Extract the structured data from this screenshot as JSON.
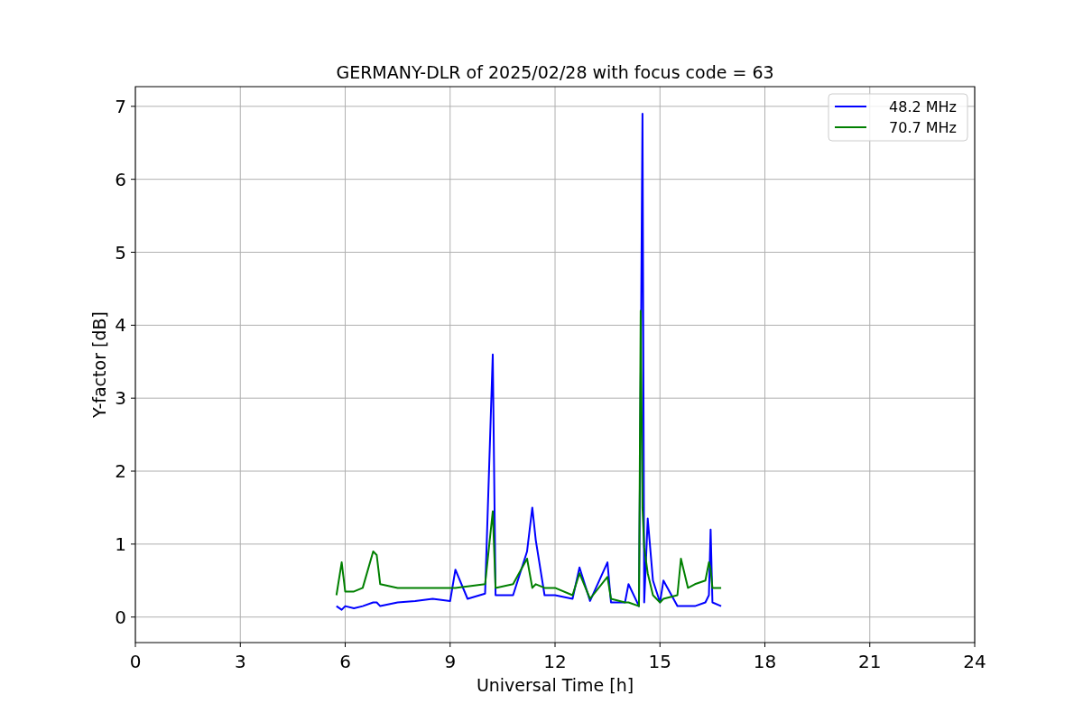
{
  "figure": {
    "chart_data": {
      "type": "line",
      "title": "GERMANY-DLR of 2025/02/28 with focus code = 63",
      "xlabel": "Universal Time [h]",
      "ylabel": "Y-factor [dB]",
      "x": [
        5.75,
        5.9,
        6.0,
        6.25,
        6.5,
        6.8,
        6.9,
        7.0,
        7.5,
        8.0,
        8.5,
        9.0,
        9.15,
        9.5,
        10.0,
        10.22,
        10.3,
        10.8,
        11.2,
        11.35,
        11.45,
        11.7,
        12.0,
        12.5,
        12.7,
        13.0,
        13.5,
        13.6,
        14.0,
        14.1,
        14.4,
        14.45,
        14.5,
        14.55,
        14.65,
        14.8,
        15.0,
        15.1,
        15.5,
        15.6,
        15.8,
        16.0,
        16.3,
        16.4,
        16.45,
        16.5,
        16.75
      ],
      "series": [
        {
          "name": "48.2 MHz",
          "color": "#0000ff",
          "values": [
            0.15,
            0.1,
            0.15,
            0.12,
            0.15,
            0.2,
            0.2,
            0.15,
            0.2,
            0.22,
            0.25,
            0.22,
            0.65,
            0.25,
            0.32,
            3.6,
            0.3,
            0.3,
            0.9,
            1.5,
            1.05,
            0.3,
            0.3,
            0.25,
            0.68,
            0.22,
            0.75,
            0.2,
            0.2,
            0.45,
            0.15,
            3.2,
            6.9,
            0.2,
            1.35,
            0.5,
            0.2,
            0.5,
            0.15,
            0.15,
            0.15,
            0.15,
            0.2,
            0.3,
            1.2,
            0.2,
            0.15
          ]
        },
        {
          "name": "70.7 MHz",
          "color": "#008000",
          "values": [
            0.3,
            0.75,
            0.35,
            0.35,
            0.4,
            0.9,
            0.85,
            0.45,
            0.4,
            0.4,
            0.4,
            0.4,
            0.4,
            0.42,
            0.45,
            1.45,
            0.4,
            0.45,
            0.8,
            0.4,
            0.45,
            0.4,
            0.4,
            0.3,
            0.6,
            0.25,
            0.55,
            0.25,
            0.2,
            0.2,
            0.15,
            4.2,
            1.5,
            0.95,
            0.6,
            0.3,
            0.2,
            0.25,
            0.3,
            0.8,
            0.4,
            0.45,
            0.5,
            0.75,
            0.65,
            0.4,
            0.4
          ]
        }
      ],
      "grid": true,
      "legend": true,
      "xlim": [
        0,
        24
      ],
      "ylim": [
        -0.35,
        7.27
      ],
      "xticks": [
        0,
        3,
        6,
        9,
        12,
        15,
        18,
        21,
        24
      ],
      "yticks": [
        0,
        1,
        2,
        3,
        4,
        5,
        6,
        7
      ]
    }
  }
}
